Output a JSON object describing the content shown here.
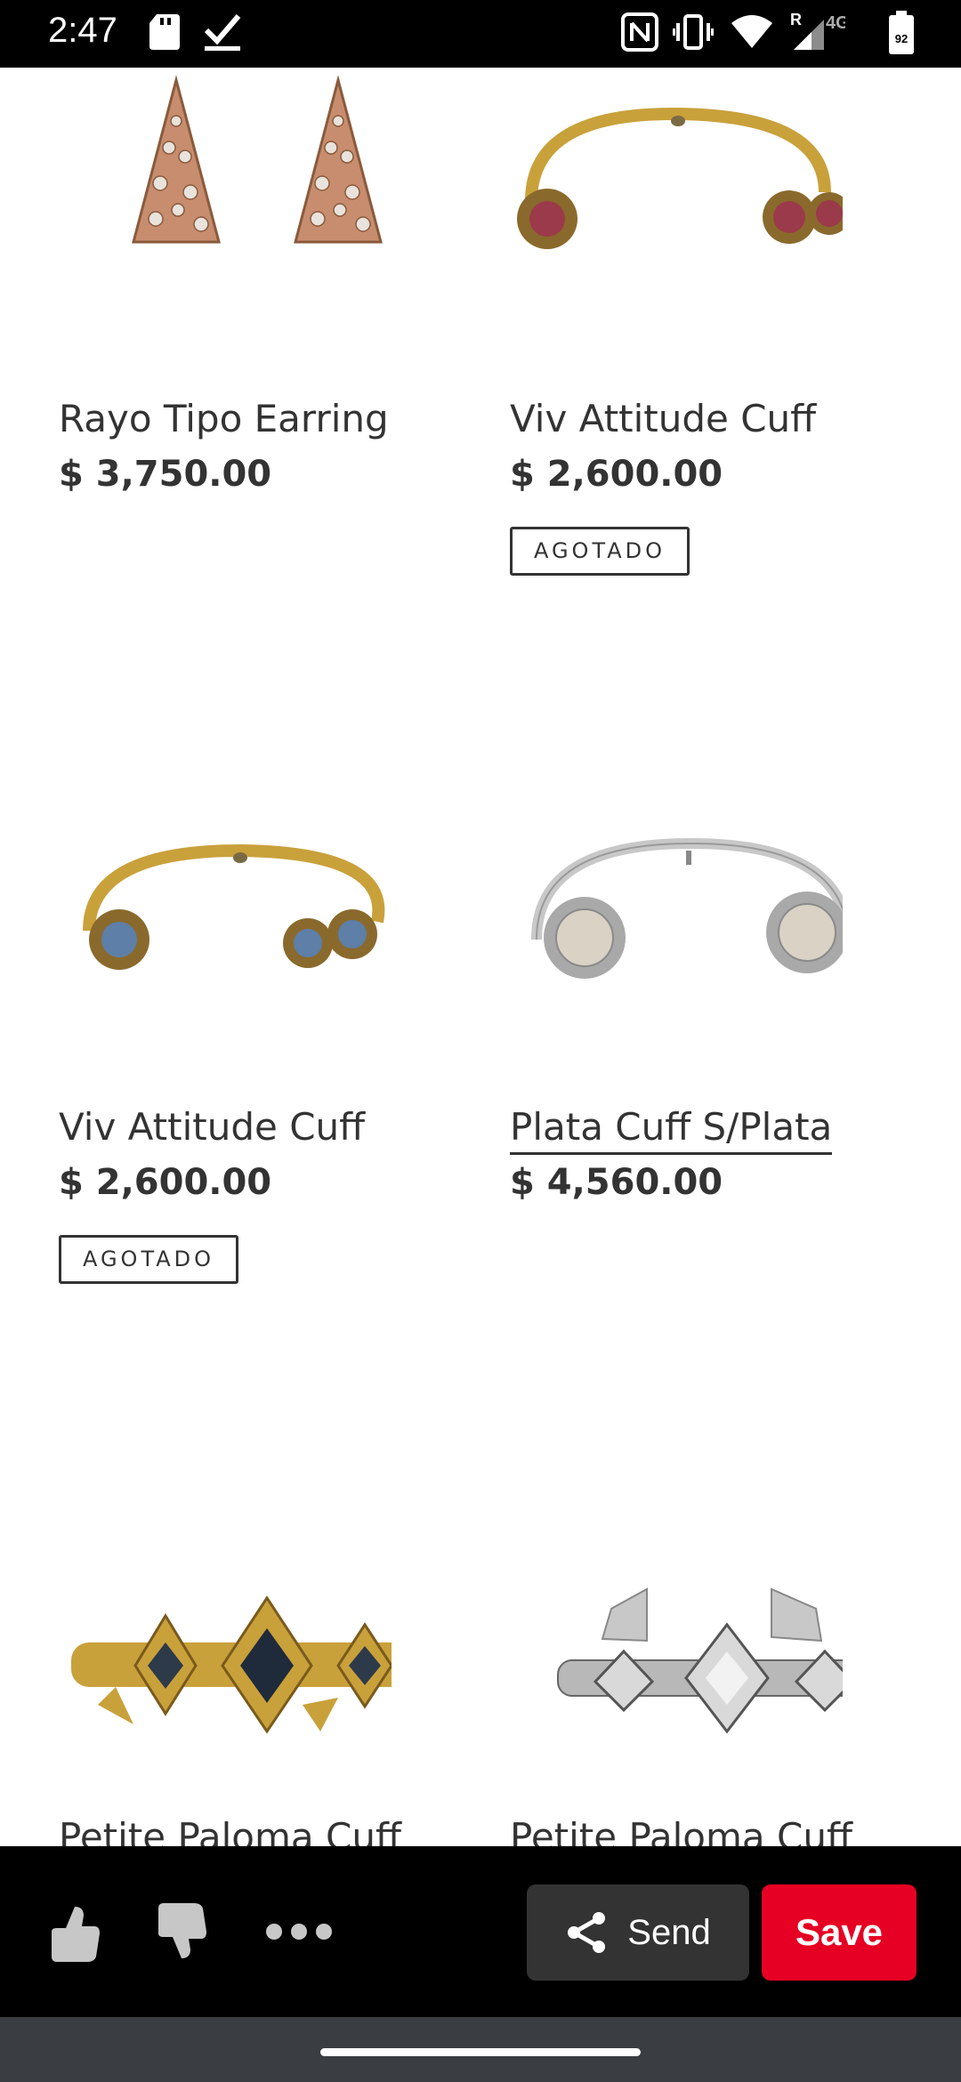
{
  "status_bar": {
    "time": "2:47",
    "network": "4G",
    "roaming": "R",
    "battery": "92"
  },
  "products": [
    {
      "title": "Rayo Tipo Earring",
      "price": "$ 3,750.00",
      "badge": ""
    },
    {
      "title": "Viv Attitude Cuff",
      "price": "$ 2,600.00",
      "badge": "AGOTADO"
    },
    {
      "title": "Viv Attitude Cuff",
      "price": "$ 2,600.00",
      "badge": "AGOTADO"
    },
    {
      "title": "Plata Cuff S/Plata",
      "price": "$ 4,560.00",
      "badge": ""
    },
    {
      "title": "Petite Paloma Cuff",
      "price": "",
      "badge": ""
    },
    {
      "title": "Petite Paloma Cuff",
      "price": "",
      "badge": ""
    }
  ],
  "action_bar": {
    "send_label": "Send",
    "save_label": "Save"
  },
  "colors": {
    "save_red": "#e60023",
    "send_gray": "#333333",
    "gold": "#c9a13b",
    "rose_gold": "#c78d6e",
    "silver": "#c8c8c8"
  },
  "icons": [
    "nfc-icon",
    "vibrate-icon",
    "wifi-icon",
    "signal-icon",
    "battery-icon",
    "sd-card-icon",
    "check-icon",
    "thumbs-up-icon",
    "thumbs-down-icon",
    "more-icon",
    "share-icon"
  ]
}
